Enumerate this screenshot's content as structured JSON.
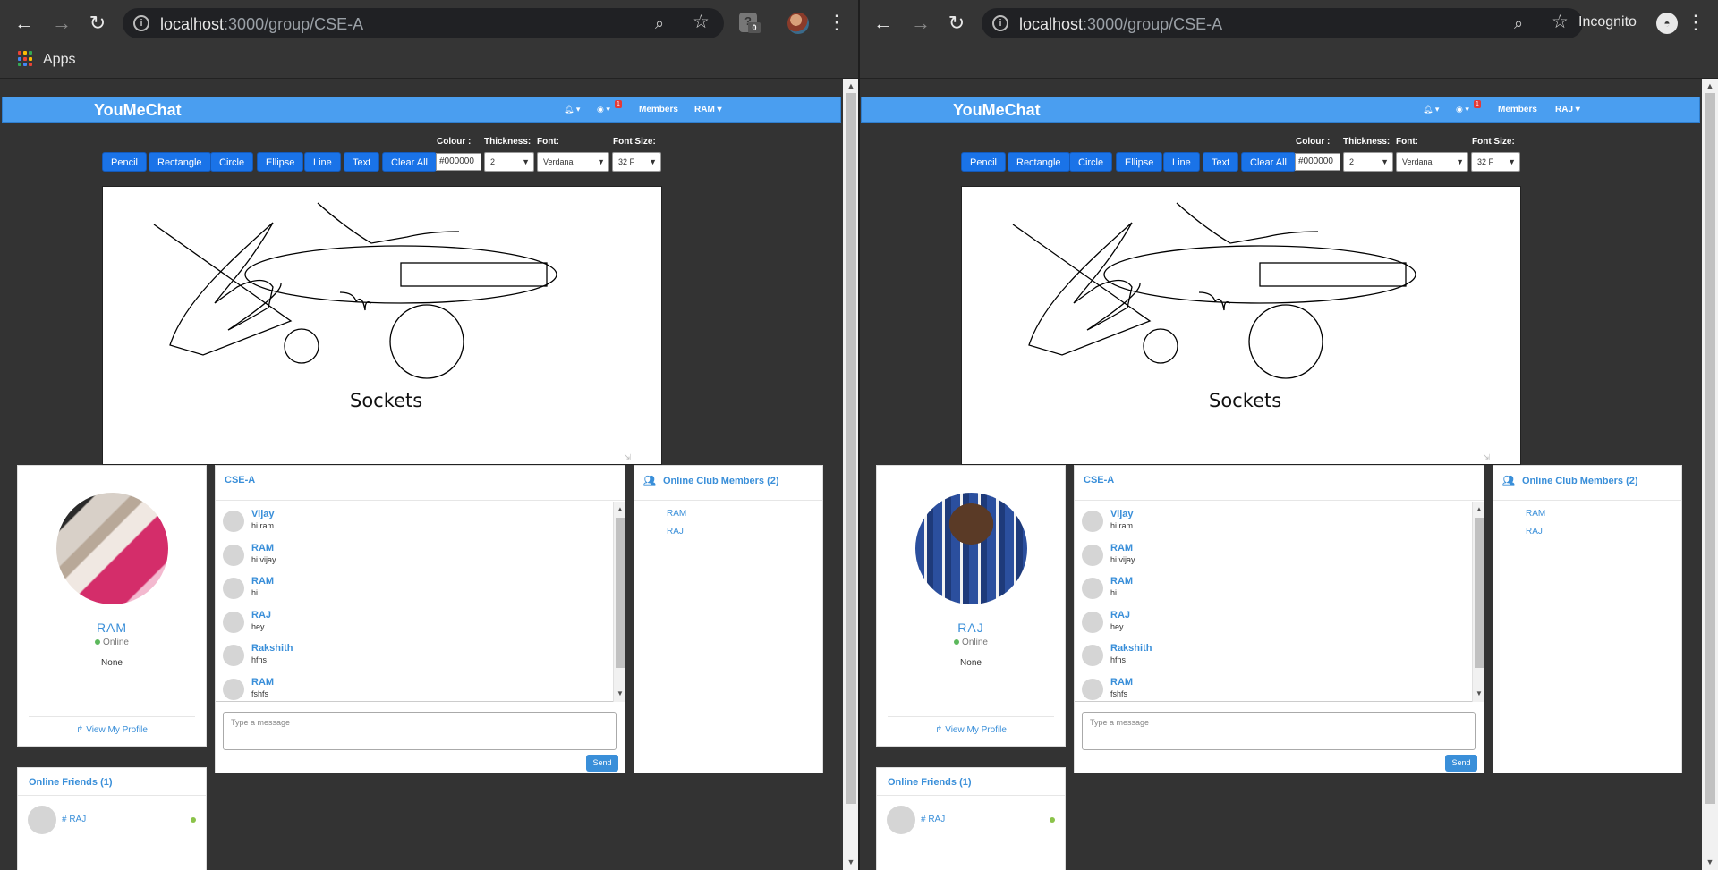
{
  "browser_left": {
    "url_host": "localhost",
    "url_path": ":3000/group/CSE-A",
    "extension_badge": "0",
    "bookmark_apps": "Apps"
  },
  "browser_right": {
    "url_host": "localhost",
    "url_path": ":3000/group/CSE-A",
    "incognito_label": "Incognito"
  },
  "colors": {
    "navbar": "#4a9ef0",
    "tool_button": "#1a73e8",
    "link": "#3a8fd9",
    "online": "#5cb85c"
  },
  "navbar": {
    "brand": "YouMeChat",
    "members_label": "Members",
    "notif_badge": "1"
  },
  "user_left": {
    "nav_user": "RAM ▾",
    "name": "RAM"
  },
  "user_right": {
    "nav_user": "RAJ ▾",
    "name": "RAJ"
  },
  "tools": {
    "buttons": [
      "Pencil",
      "Rectangle",
      "Circle",
      "Ellipse",
      "Line",
      "Text",
      "Clear All"
    ],
    "colour_label": "Colour :",
    "colour_value": "#000000",
    "thickness_label": "Thickness:",
    "thickness_value": "2",
    "font_label": "Font:",
    "font_value": "Verdana",
    "font_size_label": "Font Size:",
    "font_size_value": "32 F"
  },
  "canvas": {
    "text": "Sockets"
  },
  "profile": {
    "status": "Online",
    "about": "None",
    "view_profile": "View My Profile"
  },
  "chat": {
    "group_name": "CSE-A",
    "messages": [
      {
        "name": "Vijay",
        "text": "hi ram"
      },
      {
        "name": "RAM",
        "text": "hi vijay"
      },
      {
        "name": "RAM",
        "text": "hi"
      },
      {
        "name": "RAJ",
        "text": "hey"
      },
      {
        "name": "Rakshith",
        "text": "hfhs"
      },
      {
        "name": "RAM",
        "text": "fshfs"
      }
    ],
    "input_placeholder": "Type a message",
    "send_label": "Send"
  },
  "members": {
    "header": "Online Club Members (2)",
    "list": [
      "RAM",
      "RAJ"
    ]
  },
  "friends": {
    "header": "Online Friends (1)",
    "list": [
      "# RAJ"
    ]
  }
}
